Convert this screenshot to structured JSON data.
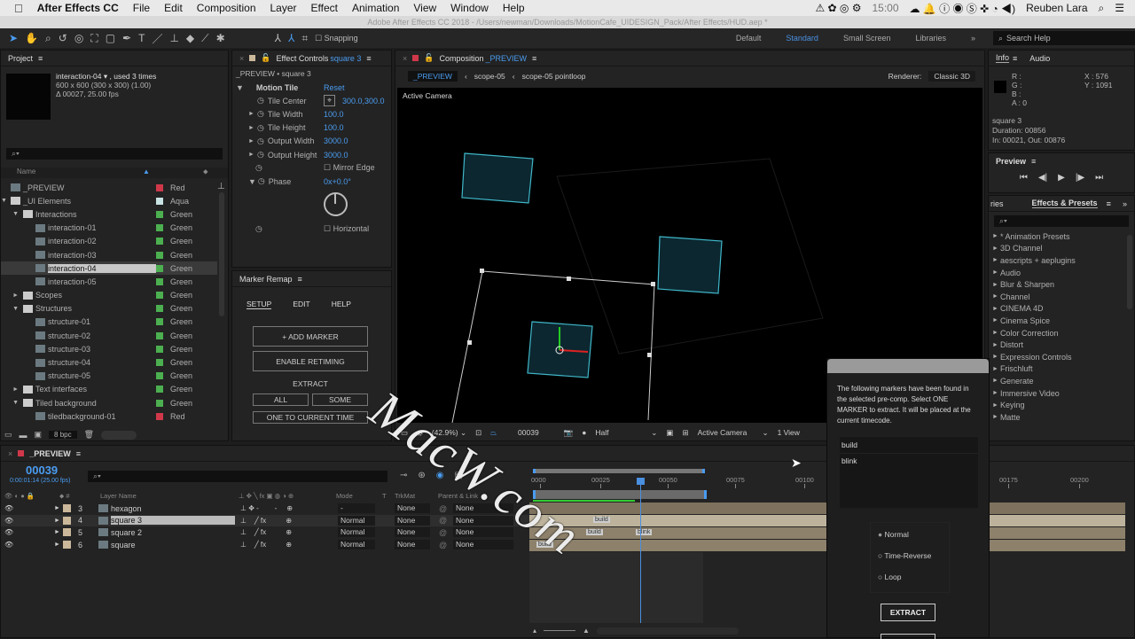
{
  "menubar": {
    "app": "After Effects CC",
    "items": [
      "File",
      "Edit",
      "Composition",
      "Layer",
      "Effect",
      "Animation",
      "View",
      "Window",
      "Help"
    ],
    "clock": "15:00",
    "user": "Reuben Lara"
  },
  "titlebar": "Adobe After Effects CC 2018 - /Users/newman/Downloads/MotionCafe_UIDESIGN_Pack/After Effects/HUD.aep *",
  "toolbar": {
    "snapping": "Snapping",
    "workspaces": [
      "Default",
      "Standard",
      "Small Screen",
      "Libraries"
    ],
    "active_workspace": "Standard",
    "search_help": "Search Help"
  },
  "project": {
    "title": "Project",
    "selected_name": "interaction-04 ▾ , used 3 times",
    "selected_dims": "600 x 600  (300 x 300) (1.00)",
    "selected_fps": "Δ 00027, 25.00 fps",
    "col_name": "Name",
    "bpc": "8 bpc",
    "items": [
      {
        "name": "_PREVIEW",
        "label": "Red",
        "color": "#d0384a",
        "indent": 0,
        "type": "comp"
      },
      {
        "name": "_UI Elements",
        "label": "Aqua",
        "color": "#c9e3e3",
        "indent": 0,
        "type": "folder",
        "open": true
      },
      {
        "name": "Interactions",
        "label": "Green",
        "color": "#4caf50",
        "indent": 1,
        "type": "folder",
        "open": true
      },
      {
        "name": "interaction-01",
        "label": "Green",
        "color": "#4caf50",
        "indent": 2,
        "type": "comp"
      },
      {
        "name": "interaction-02",
        "label": "Green",
        "color": "#4caf50",
        "indent": 2,
        "type": "comp"
      },
      {
        "name": "interaction-03",
        "label": "Green",
        "color": "#4caf50",
        "indent": 2,
        "type": "comp"
      },
      {
        "name": "interaction-04",
        "label": "Green",
        "color": "#4caf50",
        "indent": 2,
        "type": "comp",
        "selected": true
      },
      {
        "name": "interaction-05",
        "label": "Green",
        "color": "#4caf50",
        "indent": 2,
        "type": "comp"
      },
      {
        "name": "Scopes",
        "label": "Green",
        "color": "#4caf50",
        "indent": 1,
        "type": "folder",
        "open": false
      },
      {
        "name": "Structures",
        "label": "Green",
        "color": "#4caf50",
        "indent": 1,
        "type": "folder",
        "open": true
      },
      {
        "name": "structure-01",
        "label": "Green",
        "color": "#4caf50",
        "indent": 2,
        "type": "comp"
      },
      {
        "name": "structure-02",
        "label": "Green",
        "color": "#4caf50",
        "indent": 2,
        "type": "comp"
      },
      {
        "name": "structure-03",
        "label": "Green",
        "color": "#4caf50",
        "indent": 2,
        "type": "comp"
      },
      {
        "name": "structure-04",
        "label": "Green",
        "color": "#4caf50",
        "indent": 2,
        "type": "comp"
      },
      {
        "name": "structure-05",
        "label": "Green",
        "color": "#4caf50",
        "indent": 2,
        "type": "comp"
      },
      {
        "name": "Text interfaces",
        "label": "Green",
        "color": "#4caf50",
        "indent": 1,
        "type": "folder",
        "open": false
      },
      {
        "name": "Tiled background",
        "label": "Green",
        "color": "#4caf50",
        "indent": 1,
        "type": "folder",
        "open": true
      },
      {
        "name": "tiledbackground-01",
        "label": "Red",
        "color": "#d0384a",
        "indent": 2,
        "type": "comp"
      }
    ]
  },
  "effect_controls": {
    "title": "Effect Controls",
    "layer": "square 3",
    "subtitle": "_PREVIEW • square 3",
    "effect": "Motion Tile",
    "reset": "Reset",
    "props": [
      {
        "name": "Tile Center",
        "value": "300.0,300.0"
      },
      {
        "name": "Tile Width",
        "value": "100.0"
      },
      {
        "name": "Tile Height",
        "value": "100.0"
      },
      {
        "name": "Output Width",
        "value": "3000.0"
      },
      {
        "name": "Output Height",
        "value": "3000.0"
      }
    ],
    "mirror_edge": "Mirror Edge",
    "phase": "Phase",
    "phase_value": "0x+0.0°",
    "horizontal": "Horizontal"
  },
  "marker_remap": {
    "title": "Marker Remap",
    "tabs": [
      "SETUP",
      "EDIT",
      "HELP"
    ],
    "add_marker": "+ ADD MARKER",
    "enable_retiming": "ENABLE RETIMING",
    "extract": "EXTRACT",
    "all": "ALL",
    "some": "SOME",
    "one_to_current": "ONE TO CURRENT TIME"
  },
  "composition": {
    "title": "Composition",
    "comp": "_PREVIEW",
    "breadcrumbs": [
      "_PREVIEW",
      "scope-05",
      "scope-05 pointloop"
    ],
    "renderer_label": "Renderer:",
    "renderer": "Classic 3D",
    "view_label": "Active Camera",
    "footer": {
      "zoom": "(42.9%)",
      "timecode": "00039",
      "resolution": "Half",
      "camera": "Active Camera",
      "views": "1 View"
    }
  },
  "info": {
    "tabs": [
      "Info",
      "Audio"
    ],
    "r": "R :",
    "g": "G :",
    "b": "B :",
    "a": "A :  0",
    "x": "X : 576",
    "y": "Y : 1091",
    "layer": "square 3",
    "duration": "Duration: 00856",
    "inout": "In: 00021, Out: 00876"
  },
  "preview": {
    "title": "Preview"
  },
  "effects_presets": {
    "tab_prev": "ries",
    "title": "Effects & Presets",
    "items": [
      "* Animation Presets",
      "3D Channel",
      "aescripts + aeplugins",
      "Audio",
      "Blur & Sharpen",
      "Channel",
      "CINEMA 4D",
      "Cinema Spice",
      "Color Correction",
      "Distort",
      "Expression Controls",
      "Frischluft",
      "Generate",
      "Immersive Video",
      "Keying",
      "Matte"
    ]
  },
  "timeline": {
    "comp": "_PREVIEW",
    "timecode": "00039",
    "timecode_sub": "0:00:01:14 (25.00 fps)",
    "headers": {
      "name": "Layer Name",
      "mode": "Mode",
      "t": "T",
      "trkmat": "TrkMat",
      "parent": "Parent & Link"
    },
    "ruler": [
      "0000",
      "00025",
      "00050",
      "00075",
      "00100",
      "00175",
      "00200"
    ],
    "layers": [
      {
        "num": "3",
        "name": "hexagon",
        "mode": "-",
        "trkmat": "None",
        "parent": "None"
      },
      {
        "num": "4",
        "name": "square 3",
        "mode": "Normal",
        "trkmat": "None",
        "parent": "None",
        "selected": true
      },
      {
        "num": "5",
        "name": "square 2",
        "mode": "Normal",
        "trkmat": "None",
        "parent": "None"
      },
      {
        "num": "6",
        "name": "square",
        "mode": "Normal",
        "trkmat": "None",
        "parent": "None"
      }
    ],
    "markers": [
      "build",
      "build",
      "blink",
      "build"
    ]
  },
  "dialog": {
    "message": "The following markers have been found in the selected pre-comp. Select ONE MARKER to extract. It will be placed at the current timecode.",
    "markers": [
      "build",
      "blink"
    ],
    "options": [
      "Normal",
      "Time-Reverse",
      "Loop"
    ],
    "selected_option": "Normal",
    "extract": "EXTRACT"
  },
  "watermark": "MacW.com"
}
